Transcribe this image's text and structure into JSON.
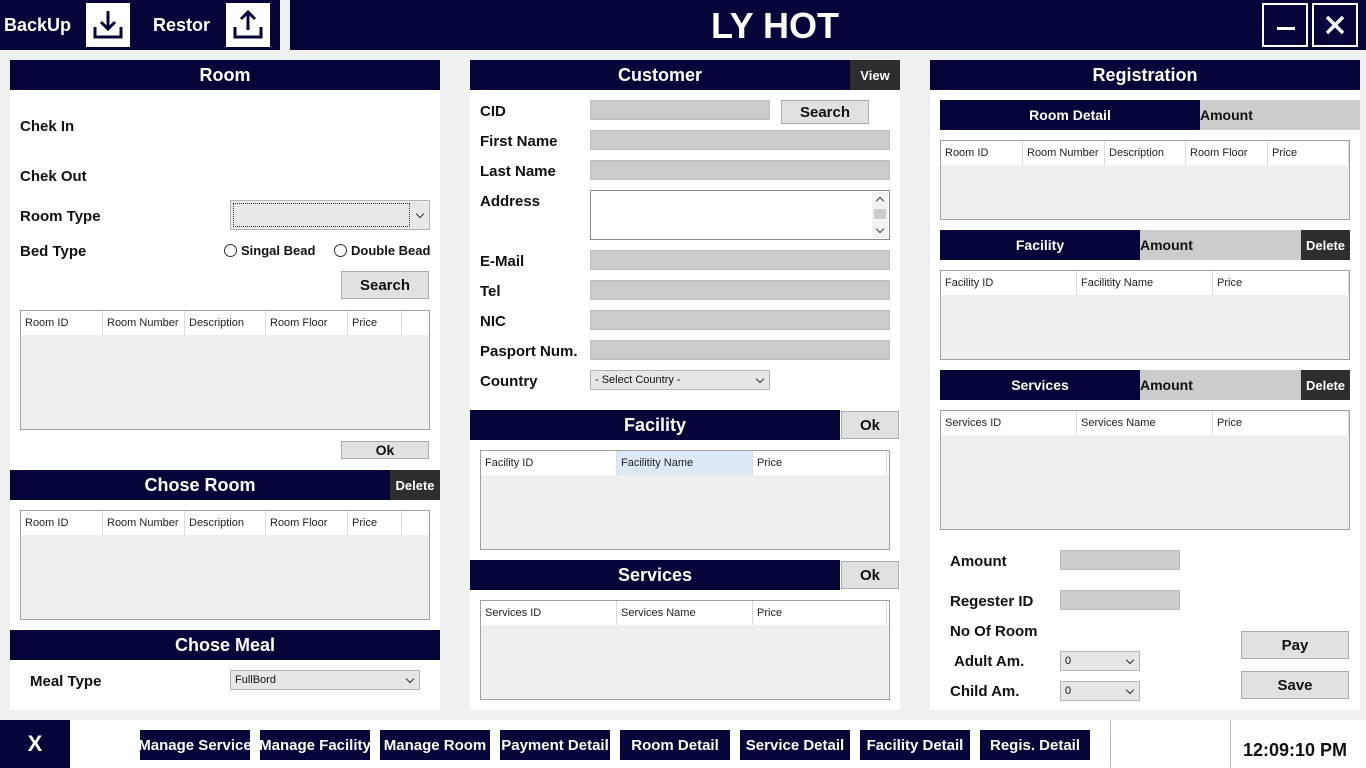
{
  "topbar": {
    "backup_label": "BackUp",
    "restore_label": "Restor",
    "app_title": "LY HOT"
  },
  "room": {
    "header": "Room",
    "check_in_label": "Chek In",
    "check_out_label": "Chek Out",
    "room_type_label": "Room Type",
    "room_type_value": "",
    "bed_type_label": "Bed Type",
    "bed_options": [
      "Singal Bead",
      "Double Bead"
    ],
    "search_label": "Search",
    "grid_columns": [
      "Room ID",
      "Room Number",
      "Description",
      "Room Floor",
      "Price"
    ],
    "ok_label": "Ok"
  },
  "chose_room": {
    "header": "Chose Room",
    "delete_label": "Delete",
    "grid_columns": [
      "Room ID",
      "Room Number",
      "Description",
      "Room Floor",
      "Price"
    ]
  },
  "chose_meal": {
    "header": "Chose Meal",
    "meal_type_label": "Meal Type",
    "meal_type_value": "FullBord"
  },
  "customer": {
    "header": "Customer",
    "view_label": "View",
    "cid_label": "CID",
    "search_label": "Search",
    "first_name_label": "First Name",
    "last_name_label": "Last Name",
    "address_label": "Address",
    "email_label": "E-Mail",
    "tel_label": "Tel",
    "nic_label": "NIC",
    "passport_label": "Pasport Num.",
    "country_label": "Country",
    "country_value": "- Select Country -"
  },
  "facility": {
    "header": "Facility",
    "ok_label": "Ok",
    "grid_columns": [
      "Facility ID",
      "Facilitity Name",
      "Price"
    ]
  },
  "services": {
    "header": "Services",
    "ok_label": "Ok",
    "grid_columns": [
      "Services ID",
      "Services  Name",
      "Price"
    ]
  },
  "registration": {
    "header": "Registration",
    "room_detail_label": "Room Detail",
    "amount_label": "Amount",
    "room_grid_columns": [
      "Room ID",
      "Room Number",
      "Description",
      "Room Floor",
      "Price"
    ],
    "facility_label": "Facility",
    "facility_amount_label": "Amount",
    "facility_delete_label": "Delete",
    "facility_grid_columns": [
      "Facility ID",
      "Facilitity Name",
      "Price"
    ],
    "services_label": "Services",
    "services_amount_label": "Amount",
    "services_delete_label": "Delete",
    "services_grid_columns": [
      "Services ID",
      "Services  Name",
      "Price"
    ],
    "total_amount_label": "Amount",
    "register_id_label": "Regester ID",
    "no_of_room_label": "No Of Room",
    "adult_label": "Adult Am.",
    "adult_value": "0",
    "child_label": "Child Am.",
    "child_value": "0",
    "pay_label": "Pay",
    "save_label": "Save"
  },
  "footer": {
    "close_label": "X",
    "nav": [
      "Manage Service",
      "Manage Facility",
      "Manage Room",
      "Payment Detail",
      "Room Detail",
      "Service Detail",
      "Facility Detail",
      "Regis. Detail"
    ],
    "clock": "12:09:10 PM"
  },
  "colors": {
    "navy": "#05053a",
    "input_gray": "#cccccc",
    "dark_button": "#2e2e2e"
  }
}
